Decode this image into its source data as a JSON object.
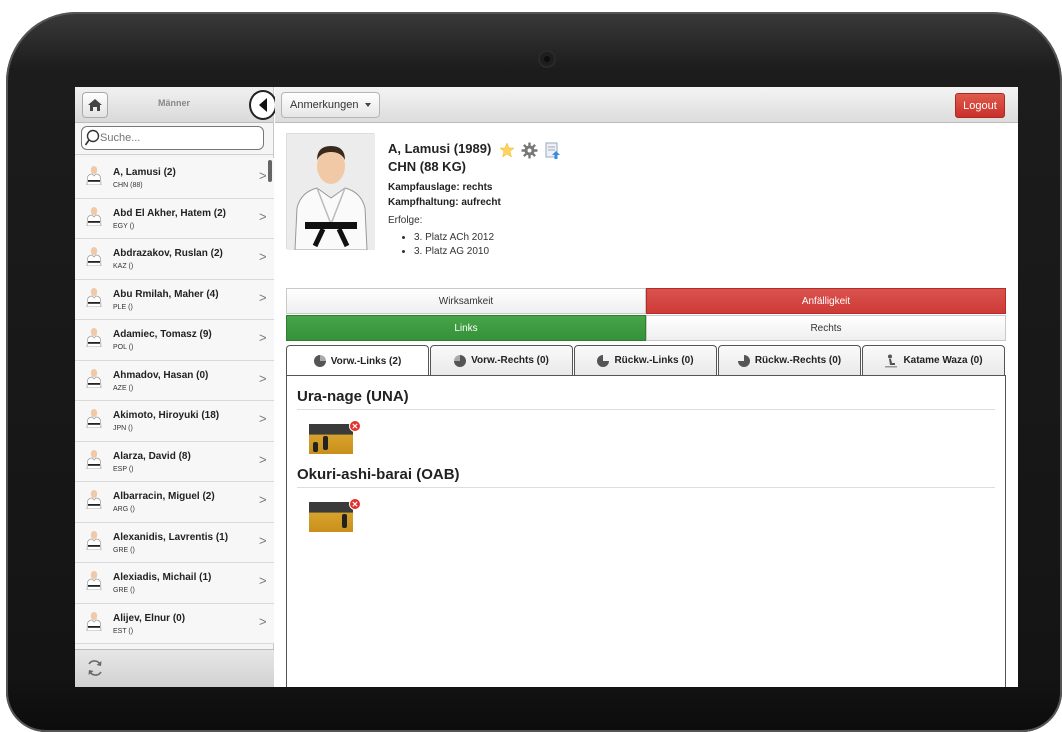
{
  "sidebar": {
    "title": "Männer",
    "search_placeholder": "Suche...",
    "items": [
      {
        "name": "A, Lamusi (2)",
        "country": "CHN (88)"
      },
      {
        "name": "Abd El Akher, Hatem (2)",
        "country": "EGY ()"
      },
      {
        "name": "Abdrazakov, Ruslan (2)",
        "country": "KAZ ()"
      },
      {
        "name": "Abu Rmilah, Maher (4)",
        "country": "PLE ()"
      },
      {
        "name": "Adamiec, Tomasz (9)",
        "country": "POL ()"
      },
      {
        "name": "Ahmadov, Hasan (0)",
        "country": "AZE ()"
      },
      {
        "name": "Akimoto, Hiroyuki (18)",
        "country": "JPN ()"
      },
      {
        "name": "Alarza, David (8)",
        "country": "ESP ()"
      },
      {
        "name": "Albarracin, Miguel (2)",
        "country": "ARG ()"
      },
      {
        "name": "Alexanidis, Lavrentis (1)",
        "country": "GRE ()"
      },
      {
        "name": "Alexiadis, Michail (1)",
        "country": "GRE ()"
      },
      {
        "name": "Alijev, Elnur (0)",
        "country": "EST ()"
      }
    ]
  },
  "topbar": {
    "notes_label": "Anmerkungen",
    "logout_label": "Logout"
  },
  "profile": {
    "name": "A, Lamusi (1989)",
    "nation": "CHN (88 KG)",
    "stance": "Kampfauslage: rechts",
    "posture": "Kampfhaltung: aufrecht",
    "achievements_label": "Erfolge:",
    "achievements": [
      "3. Platz ACh 2012",
      "3. Platz AG 2010"
    ]
  },
  "toggles": {
    "effectiveness": "Wirksamkeit",
    "vulnerability": "Anfälligkeit",
    "left": "Links",
    "right": "Rechts"
  },
  "tabs": [
    {
      "label": "Vorw.-Links (2)",
      "icon": "pie-quarter-icon"
    },
    {
      "label": "Vorw.-Rechts (0)",
      "icon": "pie-quarter-icon"
    },
    {
      "label": "Rückw.-Links (0)",
      "icon": "pie-quarter-icon"
    },
    {
      "label": "Rückw.-Rechts (0)",
      "icon": "pie-quarter-icon"
    },
    {
      "label": "Katame Waza (0)",
      "icon": "person-ground-icon"
    }
  ],
  "techniques": [
    {
      "title": "Ura-nage (UNA)"
    },
    {
      "title": "Okuri-ashi-barai (OAB)"
    }
  ],
  "colors": {
    "danger": "#d9534f",
    "success": "#47a447",
    "logout": "#c9302c"
  }
}
